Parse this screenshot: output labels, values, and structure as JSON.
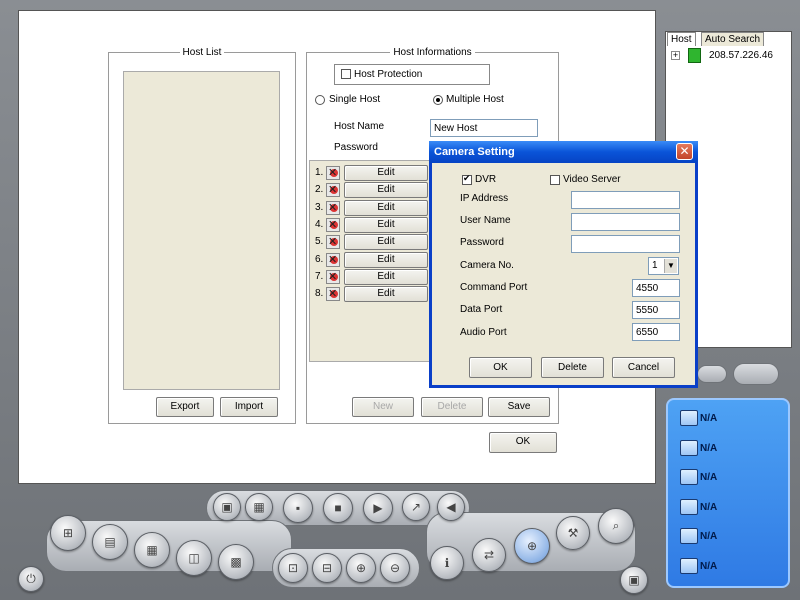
{
  "host_list": {
    "title": "Host List",
    "export_label": "Export",
    "import_label": "Import"
  },
  "host_info": {
    "title": "Host Informations",
    "host_protection_label": "Host Protection",
    "single_host_label": "Single Host",
    "multiple_host_label": "Multiple Host",
    "host_name_label": "Host Name",
    "host_name_value": "New Host",
    "password_label": "Password",
    "cameras": [
      {
        "num": "1.",
        "edit": "Edit"
      },
      {
        "num": "2.",
        "edit": "Edit"
      },
      {
        "num": "3.",
        "edit": "Edit"
      },
      {
        "num": "4.",
        "edit": "Edit"
      },
      {
        "num": "5.",
        "edit": "Edit"
      },
      {
        "num": "6.",
        "edit": "Edit"
      },
      {
        "num": "7.",
        "edit": "Edit"
      },
      {
        "num": "8.",
        "edit": "Edit"
      }
    ],
    "new_label": "New",
    "delete_label": "Delete",
    "save_label": "Save",
    "ok_label": "OK"
  },
  "dialog": {
    "title": "Camera Setting",
    "close_glyph": "✕",
    "dvr_label": "DVR",
    "dvr_checked": true,
    "video_server_label": "Video Server",
    "video_server_checked": false,
    "ip_address_label": "IP Address",
    "user_name_label": "User Name",
    "password_label": "Password",
    "camera_no_label": "Camera No.",
    "camera_no_value": "1",
    "command_port_label": "Command Port",
    "command_port_value": "4550",
    "data_port_label": "Data Port",
    "data_port_value": "5550",
    "audio_port_label": "Audio Port",
    "audio_port_value": "6550",
    "ok_label": "OK",
    "delete_label": "Delete",
    "cancel_label": "Cancel"
  },
  "host_panel": {
    "tab_host": "Host",
    "tab_auto_search": "Auto Search",
    "expand_glyph": "+",
    "host_ip": "208.57.226.46"
  },
  "status_panel": {
    "items": [
      {
        "icon": "disk-icon",
        "text": "N/A"
      },
      {
        "icon": "network-icon",
        "text": "N/A"
      },
      {
        "icon": "ip-icon",
        "text": "N/A"
      },
      {
        "icon": "server-icon",
        "text": "N/A"
      },
      {
        "icon": "film-icon",
        "text": "N/A"
      },
      {
        "icon": "camera-net-icon",
        "text": "N/A"
      }
    ]
  },
  "colors": {
    "dialog_titlebar": "#0a54d8",
    "status_panel": "#2f7ae4",
    "frame": "#7d8186"
  }
}
